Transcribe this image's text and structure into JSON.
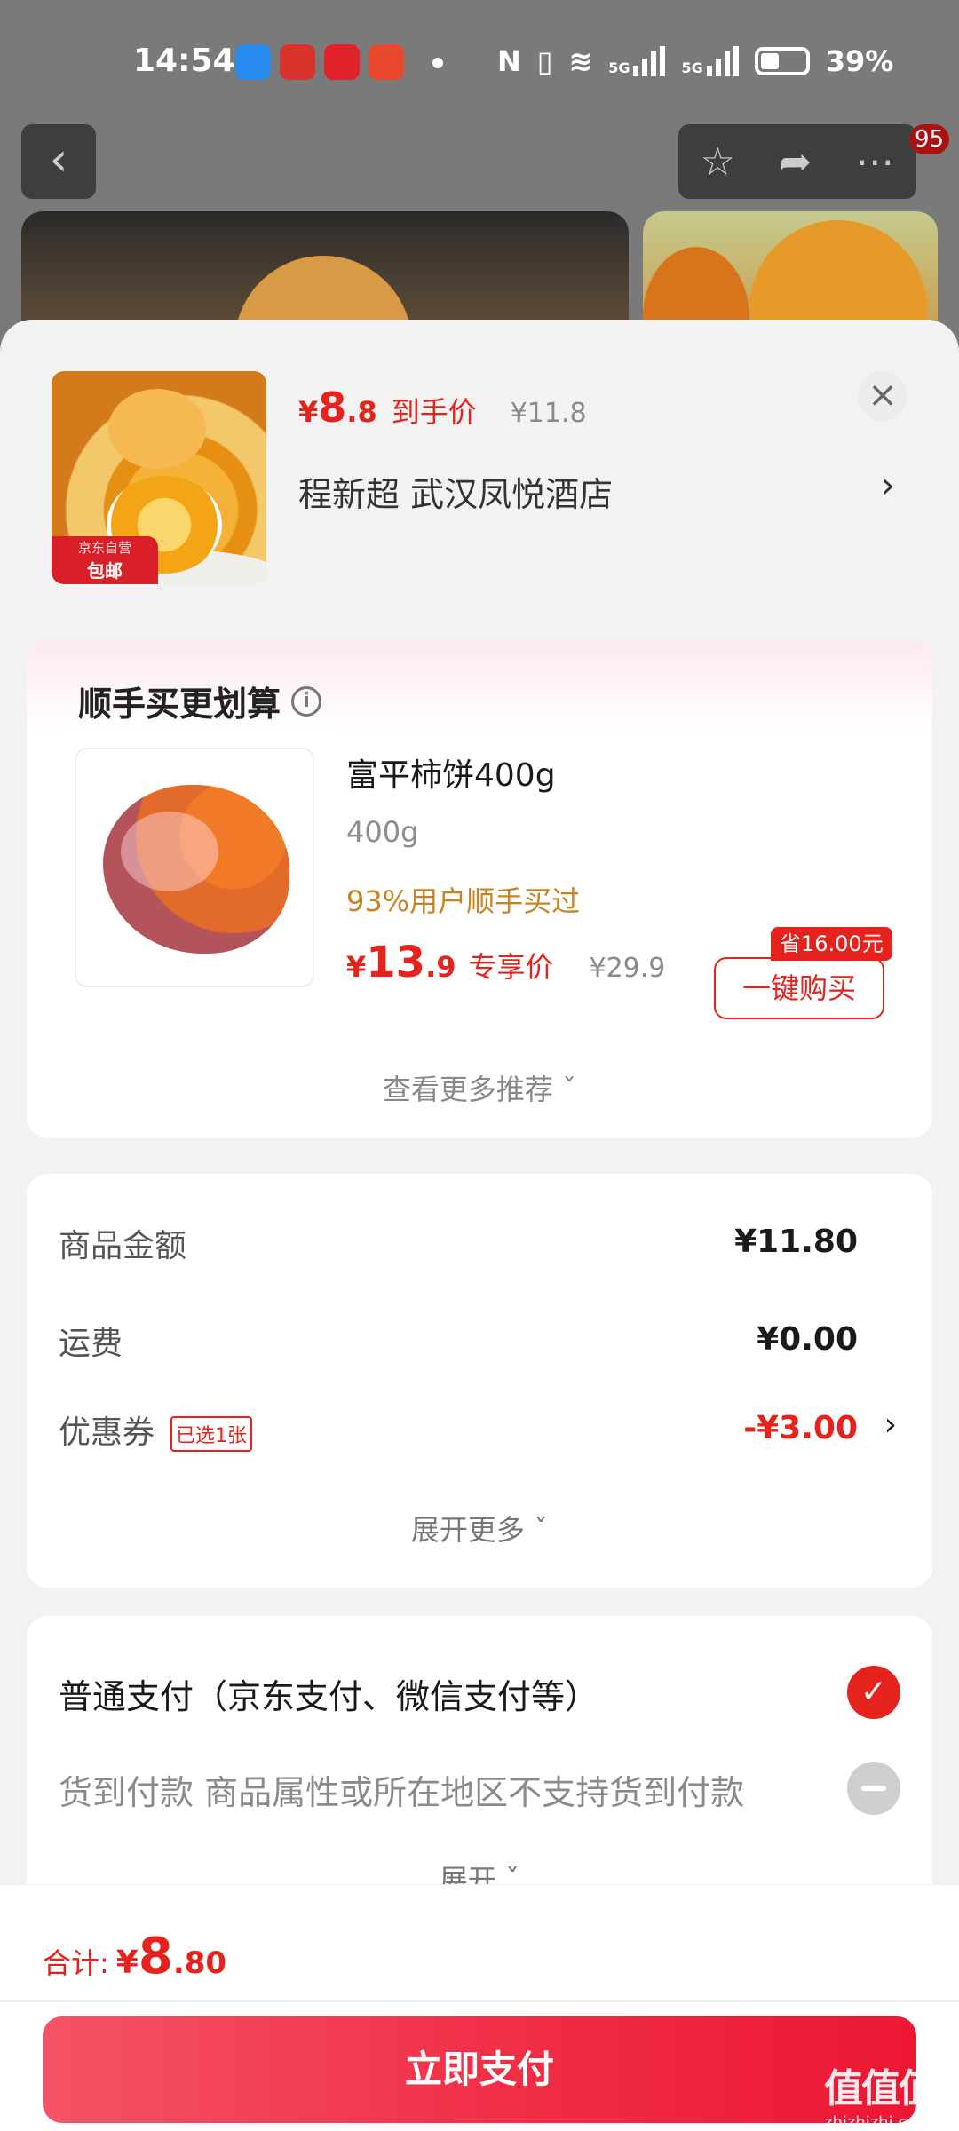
{
  "status_bar": {
    "time": "14:54",
    "battery": "39%",
    "network_labels": [
      "5G",
      "5G"
    ]
  },
  "nav": {
    "back_icon": "chevron-left-icon",
    "actions": [
      "star-icon",
      "share-icon",
      "more-icon"
    ],
    "badge": "95"
  },
  "product": {
    "price_symbol": "¥",
    "price_int": "8",
    "price_dec": ".8",
    "price_label": "到手价",
    "original_price": "¥11.8",
    "thumb_tag_top": "京东自营",
    "thumb_tag_main": "包邮",
    "address": "程新超  武汉凤悦酒店",
    "address_arrow": "›",
    "close": "×"
  },
  "recommend": {
    "title": "顺手买更划算",
    "info": "i",
    "item": {
      "name": "富平柿饼400g",
      "spec": "400g",
      "purchase_rate": "93%用户顺手买过",
      "price_symbol": "¥",
      "price_int": "13",
      "price_dec": ".9",
      "price_label": "专享价",
      "original_price": "¥29.9",
      "save_chip": "省16.00元",
      "buy_button": "一键购买"
    },
    "more": "查看更多推荐 ˇ"
  },
  "amounts": {
    "rows": [
      {
        "label": "商品金额",
        "value": "¥11.80"
      },
      {
        "label": "运费",
        "value": "¥0.00"
      },
      {
        "label": "优惠券",
        "chip": "已选1张",
        "value": "-¥3.00",
        "arrow": "›"
      }
    ],
    "expand": "展开更多 ˇ"
  },
  "payment": {
    "options": [
      {
        "label": "普通支付（京东支付、微信支付等）",
        "selected": true
      },
      {
        "label": "货到付款   商品属性或所在地区不支持货到付款",
        "selected": false
      }
    ],
    "check": "✓",
    "expand": "展开 ˇ"
  },
  "footer": {
    "total_label": "合计:",
    "total_symbol": "¥",
    "total_int": "8",
    "total_dec": ".80",
    "pay_button": "立即支付"
  },
  "watermark": {
    "main": "值值值",
    "sub": "zhizhizhi.com"
  },
  "colors": {
    "accent": "#e5231c",
    "pay_button": "#f02a43",
    "gold": "#c98421"
  }
}
